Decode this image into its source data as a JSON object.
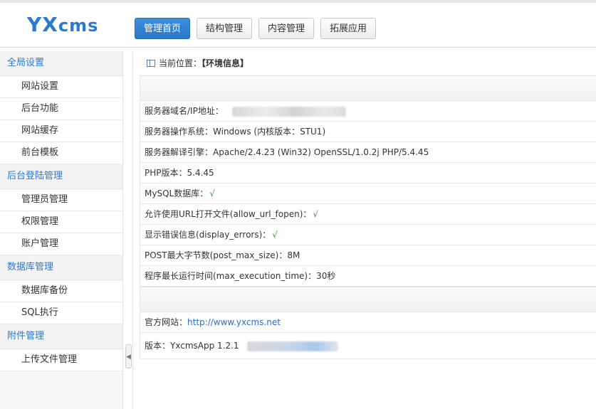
{
  "header": {
    "logo_main": "YX",
    "logo_sub": "cms",
    "nav": [
      {
        "label": "管理首页",
        "active": true
      },
      {
        "label": "结构管理"
      },
      {
        "label": "内容管理"
      },
      {
        "label": "拓展应用"
      }
    ]
  },
  "sidebar": {
    "groups": [
      {
        "title": "全局设置",
        "items": [
          "网站设置",
          "后台功能",
          "网站缓存",
          "前台模板"
        ]
      },
      {
        "title": "后台登陆管理",
        "items": [
          "管理员管理",
          "权限管理",
          "账户管理"
        ]
      },
      {
        "title": "数据库管理",
        "items": [
          "数据库备份",
          "SQL执行"
        ]
      },
      {
        "title": "附件管理",
        "items": [
          "上传文件管理"
        ]
      }
    ]
  },
  "breadcrumb": {
    "prefix": "当前位置：",
    "current": "【环境信息】"
  },
  "server_info": {
    "domain_ip_label": "服务器域名/IP地址：",
    "os_label": "服务器操作系统：",
    "os_value": "Windows (内核版本：STU1)",
    "engine_label": "服务器解译引擎：",
    "engine_value": "Apache/2.4.23 (Win32) OpenSSL/1.0.2j PHP/5.4.45",
    "php_label": "PHP版本：",
    "php_value": "5.4.45",
    "mysql_label": "MySQL数据库：",
    "mysql_value": "√",
    "url_fopen_label": "允许使用URL打开文件(allow_url_fopen)：",
    "url_fopen_value": "√",
    "display_errors_label": "显示错误信息(display_errors)：",
    "display_errors_value": "√",
    "post_max_label": "POST最大字节数(post_max_size)：",
    "post_max_value": "8M",
    "max_exec_label": "程序最长运行时间(max_execution_time)：",
    "max_exec_value": "30秒"
  },
  "about": {
    "site_label": "官方网站：",
    "site_url": "http://www.yxcms.net",
    "version_label": "版本：",
    "version_value": "YxcmsApp 1.2.1"
  }
}
